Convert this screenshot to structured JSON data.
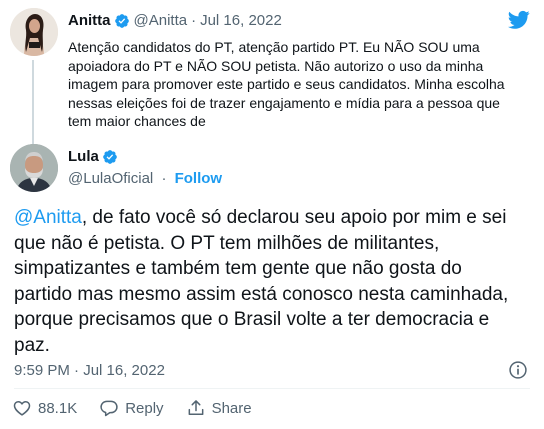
{
  "quoted_tweet": {
    "author_name": "Anitta",
    "handle": "@Anitta",
    "separator": "·",
    "date": "Jul 16, 2022",
    "text": "Atenção candidatos do PT, atenção partido PT. Eu NÃO SOU uma apoiadora do PT e NÃO SOU petista. Não autorizo o uso da minha imagem para promover este partido e seus candidatos. Minha escolha nessas eleições foi de trazer engajamento e mídia para a pessoa que tem maior chances de"
  },
  "reply": {
    "author_name": "Lula",
    "handle": "@LulaOficial",
    "separator": "·",
    "follow_label": "Follow",
    "mention": "@Anitta",
    "text": ", de fato você só declarou seu apoio por mim e sei que não é petista. O PT tem milhões de militantes, simpatizantes e também tem gente que não gosta do partido mas mesmo assim está conosco nesta caminhada, porque precisamos que o Brasil volte a ter democracia e paz.",
    "timestamp": "9:59 PM · Jul 16, 2022"
  },
  "actions": {
    "like_count": "88.1K",
    "reply_label": "Reply",
    "share_label": "Share"
  },
  "icons": [
    "verified-badge-icon",
    "twitter-bird-icon",
    "info-icon",
    "heart-icon",
    "reply-icon",
    "share-icon"
  ],
  "colors": {
    "accent": "#1d9bf0",
    "text": "#0f1419",
    "secondary": "#536471"
  }
}
